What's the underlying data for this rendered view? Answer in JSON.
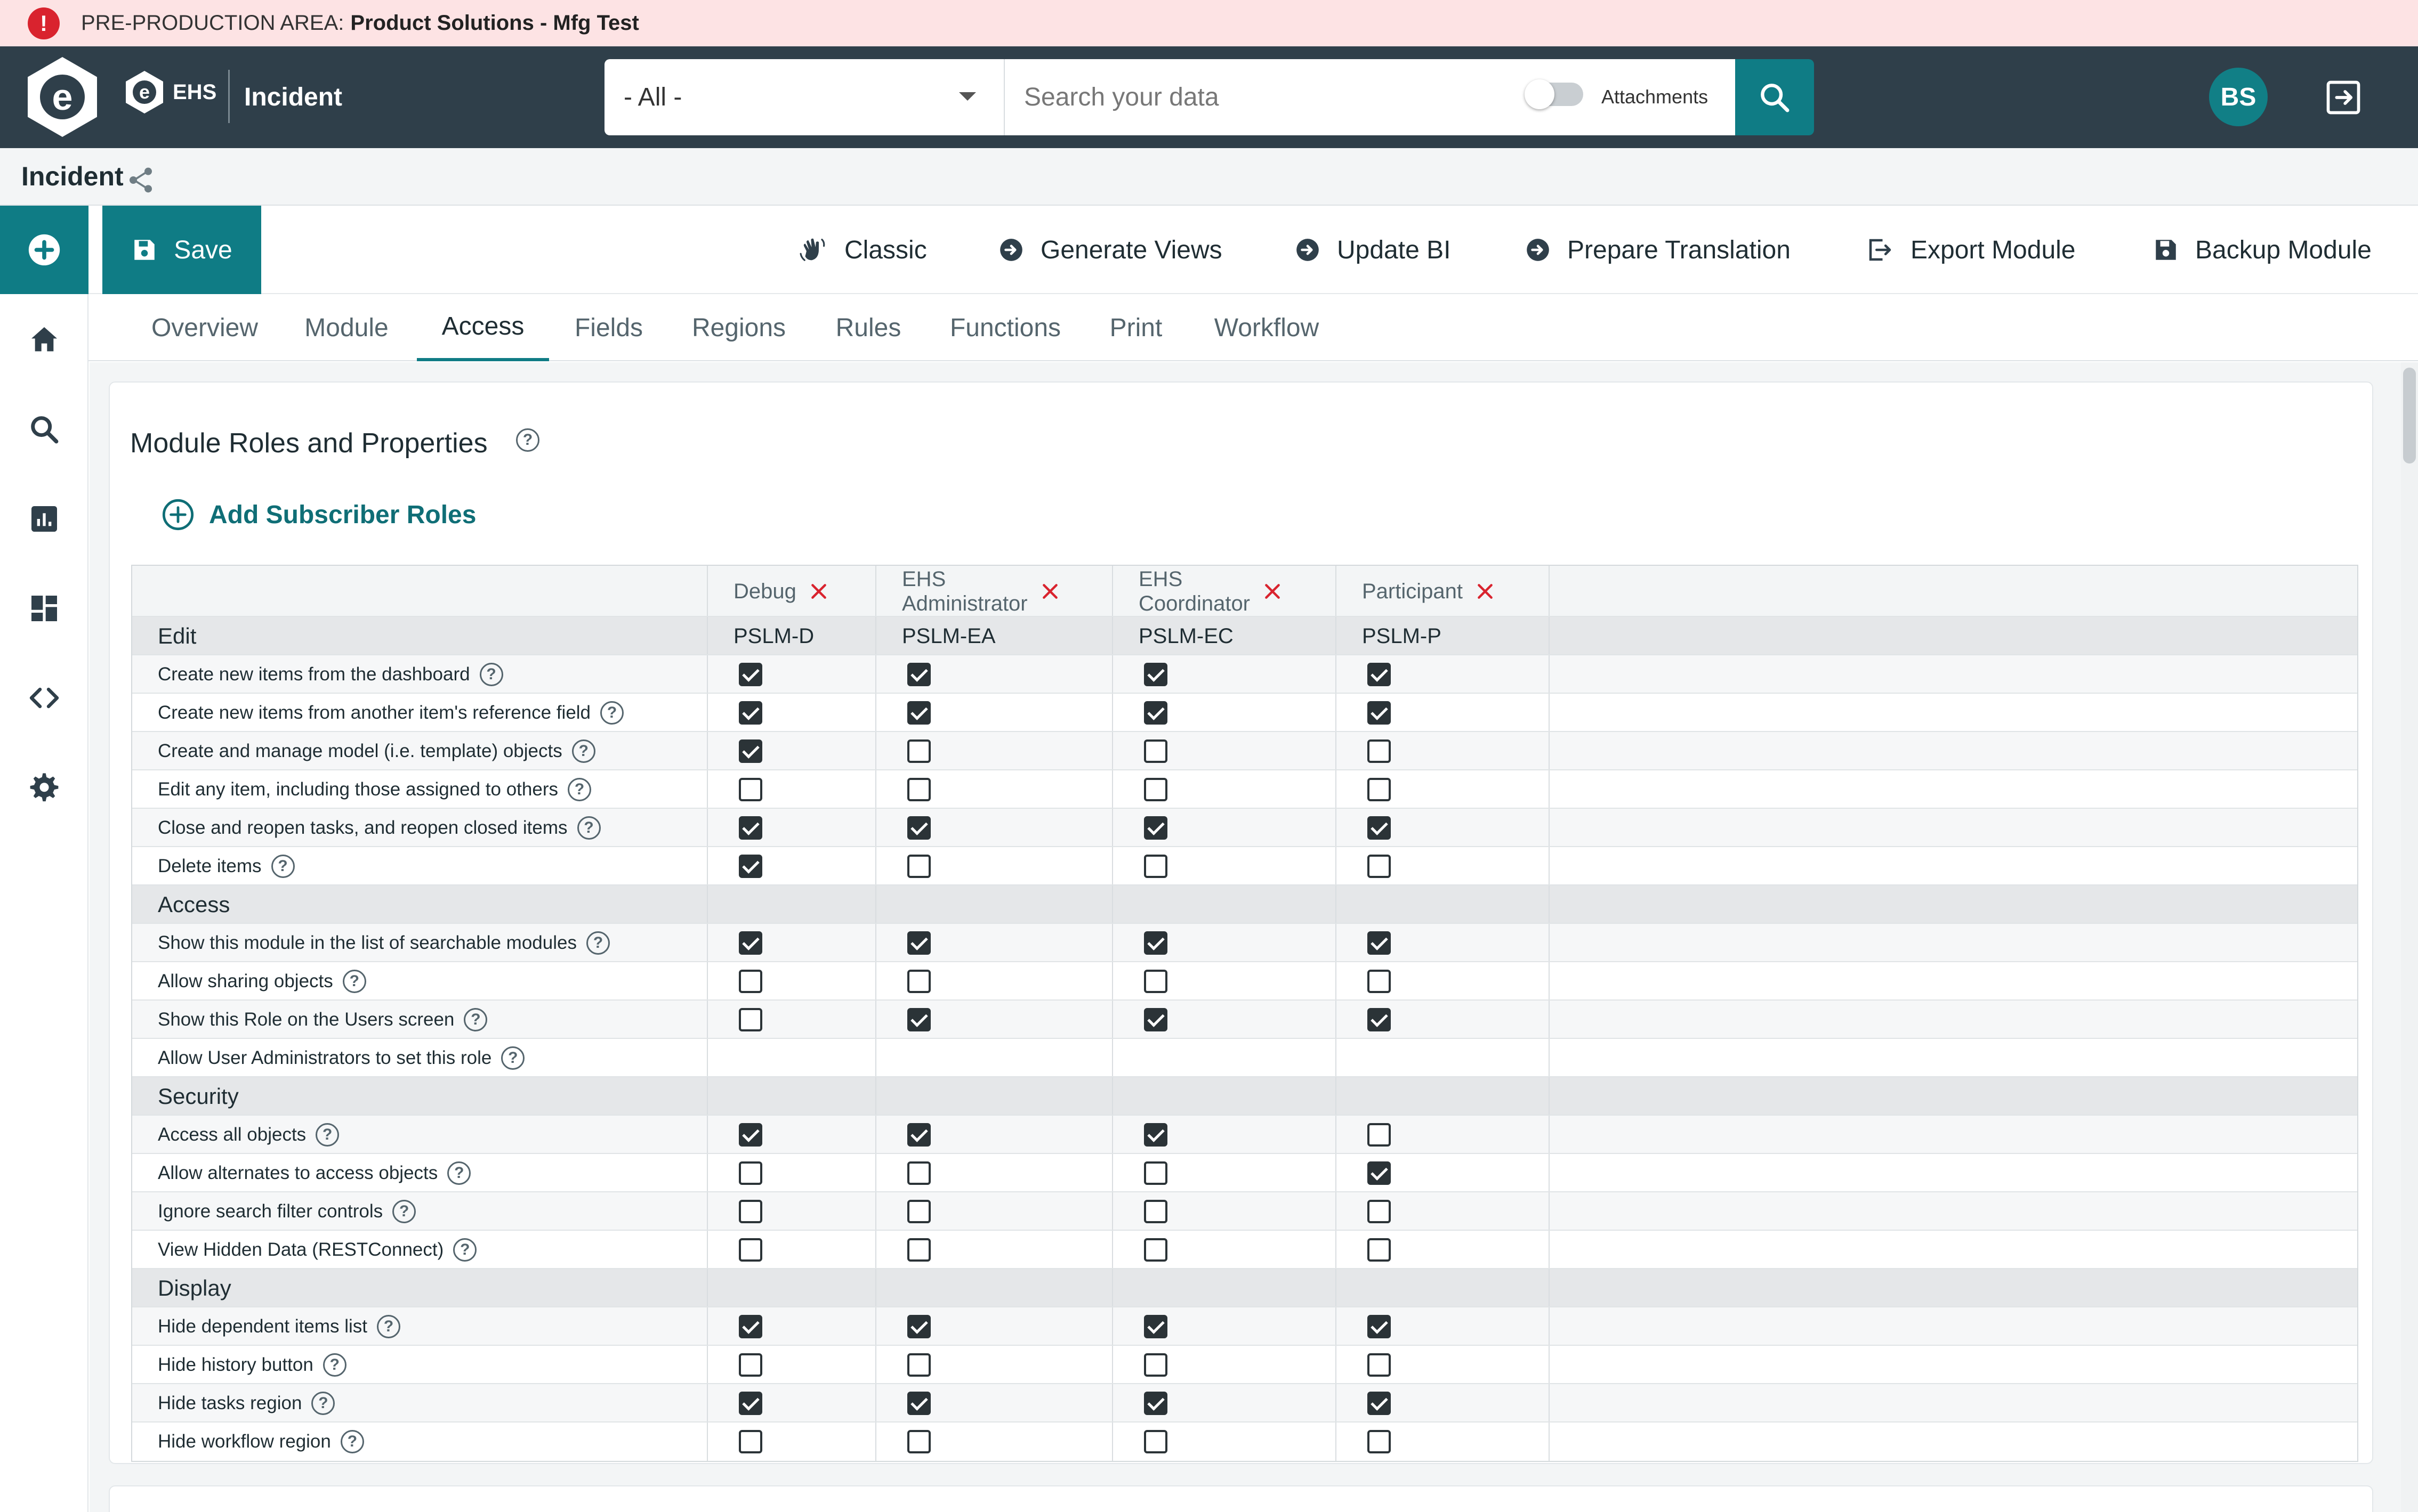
{
  "banner": {
    "prefix": "PRE-PRODUCTION AREA:",
    "environment": "Product Solutions - Mfg Test"
  },
  "header": {
    "product": "EHS",
    "app_name": "Incident",
    "scope_select": "- All -",
    "search_placeholder": "Search your data",
    "attachments_label": "Attachments",
    "attachments_on": false,
    "user_initials": "BS"
  },
  "breadcrumb": {
    "title": "Incident"
  },
  "toolbar": {
    "save": "Save",
    "classic": "Classic",
    "generate_views": "Generate Views",
    "update_bi": "Update BI",
    "prepare_translation": "Prepare Translation",
    "export_module": "Export Module",
    "backup_module": "Backup Module"
  },
  "tabs": [
    "Overview",
    "Module",
    "Access",
    "Fields",
    "Regions",
    "Rules",
    "Functions",
    "Print",
    "Workflow"
  ],
  "active_tab": "Access",
  "card": {
    "title": "Module Roles and Properties",
    "add_roles": "Add Subscriber Roles"
  },
  "roles": [
    {
      "name": "Debug",
      "code": "PSLM-D"
    },
    {
      "name": "EHS\nAdministrator",
      "code": "PSLM-EA"
    },
    {
      "name": "EHS\nCoordinator",
      "code": "PSLM-EC"
    },
    {
      "name": "Participant",
      "code": "PSLM-P"
    }
  ],
  "sections": [
    {
      "title": "Edit",
      "rows": [
        {
          "label": "Create new items from the dashboard",
          "checks": [
            true,
            true,
            true,
            true
          ]
        },
        {
          "label": "Create new items from another item's reference field",
          "checks": [
            true,
            true,
            true,
            true
          ]
        },
        {
          "label": "Create and manage model (i.e. template) objects",
          "checks": [
            true,
            false,
            false,
            false
          ]
        },
        {
          "label": "Edit any item, including those assigned to others",
          "checks": [
            false,
            false,
            false,
            false
          ]
        },
        {
          "label": "Close and reopen tasks, and reopen closed items",
          "checks": [
            true,
            true,
            true,
            true
          ]
        },
        {
          "label": "Delete items",
          "checks": [
            true,
            false,
            false,
            false
          ]
        }
      ]
    },
    {
      "title": "Access",
      "rows": [
        {
          "label": "Show this module in the list of searchable modules",
          "checks": [
            true,
            true,
            true,
            true
          ]
        },
        {
          "label": "Allow sharing objects",
          "checks": [
            false,
            false,
            false,
            false
          ]
        },
        {
          "label": "Show this Role on the Users screen",
          "checks": [
            false,
            true,
            true,
            true
          ]
        },
        {
          "label": "Allow User Administrators to set this role",
          "checks": null
        }
      ]
    },
    {
      "title": "Security",
      "rows": [
        {
          "label": "Access all objects",
          "checks": [
            true,
            true,
            true,
            false
          ]
        },
        {
          "label": "Allow alternates to access objects",
          "checks": [
            false,
            false,
            false,
            true
          ]
        },
        {
          "label": "Ignore search filter controls",
          "checks": [
            false,
            false,
            false,
            false
          ]
        },
        {
          "label": "View Hidden Data (RESTConnect)",
          "checks": [
            false,
            false,
            false,
            false
          ]
        }
      ]
    },
    {
      "title": "Display",
      "rows": [
        {
          "label": "Hide dependent items list",
          "checks": [
            true,
            true,
            true,
            true
          ]
        },
        {
          "label": "Hide history button",
          "checks": [
            false,
            false,
            false,
            false
          ]
        },
        {
          "label": "Hide tasks region",
          "checks": [
            true,
            true,
            true,
            true
          ]
        },
        {
          "label": "Hide workflow region",
          "checks": [
            false,
            false,
            false,
            false
          ]
        }
      ]
    }
  ],
  "colors": {
    "banner_bg": "#fde3e4",
    "topbar_bg": "#2f3f4a",
    "accent": "#0f7c85",
    "alert": "#d9232e",
    "remove_x": "#d9232e"
  },
  "icons": {
    "sidebar": [
      "add-icon",
      "home-icon",
      "search-icon",
      "reports-icon",
      "dashboard-icon",
      "code-icon",
      "settings-icon"
    ]
  }
}
